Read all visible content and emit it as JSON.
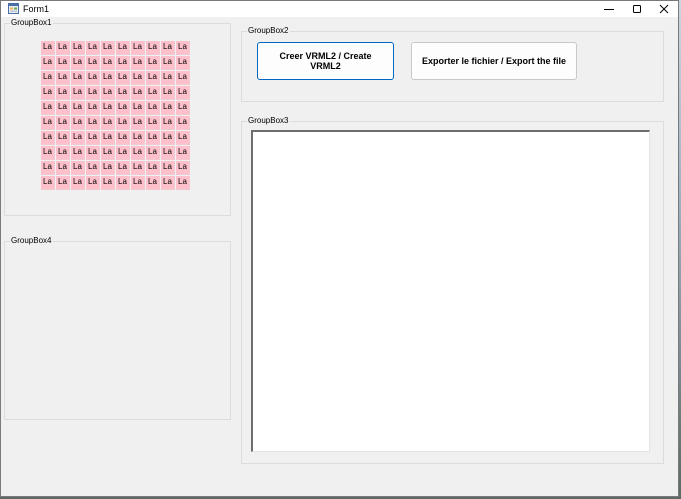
{
  "window": {
    "title": "Form1"
  },
  "groupbox1": {
    "label": "GroupBox1",
    "cell_text": "La",
    "rows": 10,
    "cols": 10,
    "cell_color": "#ffc0cb"
  },
  "groupbox2": {
    "label": "GroupBox2",
    "create_button": "Creer VRML2 / Create VRML2",
    "export_button": "Exporter le fichier / Export the file"
  },
  "groupbox3": {
    "label": "GroupBox3",
    "text_value": ""
  },
  "groupbox4": {
    "label": "GroupBox4"
  },
  "colors": {
    "window_bg": "#f0f0f0",
    "accent": "#0067c0"
  },
  "icons": {
    "app": "form-app-icon",
    "minimize": "minimize-icon",
    "maximize": "maximize-icon",
    "close": "close-icon"
  }
}
